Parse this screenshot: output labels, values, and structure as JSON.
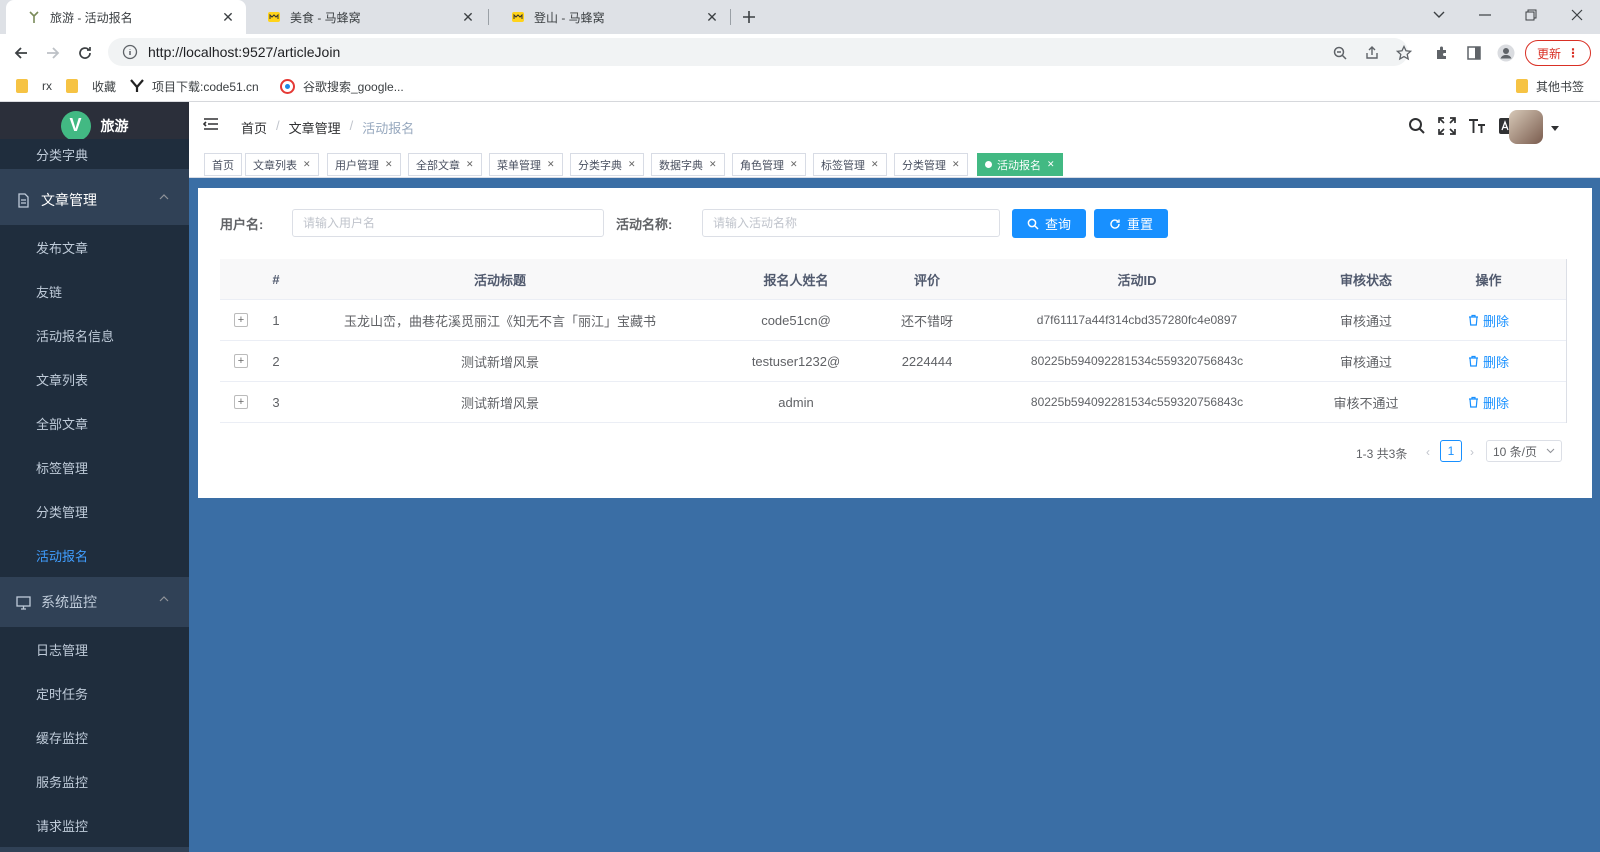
{
  "browser": {
    "tabs": [
      {
        "title": "旅游 - 活动报名",
        "active": true
      },
      {
        "title": "美食 - 马蜂窝",
        "active": false
      },
      {
        "title": "登山 - 马蜂窝",
        "active": false
      }
    ],
    "url": "http://localhost:9527/articleJoin",
    "update_label": "更新",
    "bookmarks": [
      "rx",
      "收藏",
      "项目下载:code51.cn",
      "谷歌搜索_google...",
      "其他书签"
    ]
  },
  "sidebar": {
    "logo_letter": "V",
    "app_title": "旅游",
    "top_partial_item": "分类字典",
    "article_group": "文章管理",
    "article_items": [
      "发布文章",
      "友链",
      "活动报名信息",
      "文章列表",
      "全部文章",
      "标签管理",
      "分类管理",
      "活动报名"
    ],
    "active_item": "活动报名",
    "monitor_group": "系统监控",
    "monitor_items": [
      "日志管理",
      "定时任务",
      "缓存监控",
      "服务监控",
      "请求监控"
    ]
  },
  "navbar": {
    "breadcrumb": [
      "首页",
      "文章管理",
      "活动报名"
    ]
  },
  "tags": [
    {
      "label": "首页",
      "closable": false
    },
    {
      "label": "文章列表",
      "closable": true
    },
    {
      "label": "用户管理",
      "closable": true
    },
    {
      "label": "全部文章",
      "closable": true
    },
    {
      "label": "菜单管理",
      "closable": true
    },
    {
      "label": "分类字典",
      "closable": true
    },
    {
      "label": "数据字典",
      "closable": true
    },
    {
      "label": "角色管理",
      "closable": true
    },
    {
      "label": "标签管理",
      "closable": true
    },
    {
      "label": "分类管理",
      "closable": true
    },
    {
      "label": "活动报名",
      "closable": true,
      "active": true
    }
  ],
  "search": {
    "username_label": "用户名:",
    "username_placeholder": "请输入用户名",
    "activity_label": "活动名称:",
    "activity_placeholder": "请输入活动名称",
    "query_label": "查询",
    "reset_label": "重置"
  },
  "table": {
    "columns": [
      "#",
      "活动标题",
      "报名人姓名",
      "评价",
      "活动ID",
      "审核状态",
      "操作"
    ],
    "rows": [
      {
        "index": "1",
        "title": "玉龙山峦，曲巷花溪觅丽江《知无不言「丽江」宝藏书",
        "name": "code51cn@",
        "rating": "还不错呀",
        "id": "d7f61117a44f314cbd357280fc4e0897",
        "status": "审核通过",
        "action": "删除"
      },
      {
        "index": "2",
        "title": "测试新增风景",
        "name": "testuser1232@",
        "rating": "2224444",
        "id": "80225b594092281534c559320756843c",
        "status": "审核通过",
        "action": "删除"
      },
      {
        "index": "3",
        "title": "测试新增风景",
        "name": "admin",
        "rating": "",
        "id": "80225b594092281534c559320756843c",
        "status": "审核不通过",
        "action": "删除"
      }
    ],
    "expand_symbol": "+"
  },
  "pagination": {
    "total_text": "1-3 共3条",
    "current_page": "1",
    "page_size": "10 条/页"
  },
  "colors": {
    "sidebar_bg": "#304156",
    "accent": "#1890ff",
    "active_tag": "#42b983",
    "page_bg": "#3a6ea5"
  }
}
